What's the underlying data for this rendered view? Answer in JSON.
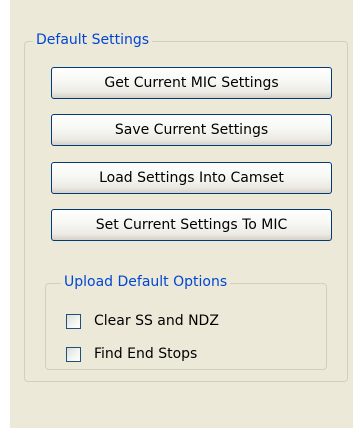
{
  "default_settings": {
    "title": "Default Settings",
    "buttons": [
      {
        "label": "Get Current MIC Settings"
      },
      {
        "label": "Save Current Settings"
      },
      {
        "label": "Load Settings Into Camset"
      },
      {
        "label": "Set Current Settings To MIC"
      }
    ],
    "upload_options": {
      "title": "Upload Default Options",
      "checkboxes": [
        {
          "label": "Clear SS and NDZ",
          "checked": false
        },
        {
          "label": "Find End Stops",
          "checked": false
        }
      ]
    }
  },
  "colors": {
    "panel_background": "#ece9d8",
    "groupbox_title": "#0046d5",
    "groupbox_border": "#d0d0bf",
    "button_border": "#003c74"
  }
}
